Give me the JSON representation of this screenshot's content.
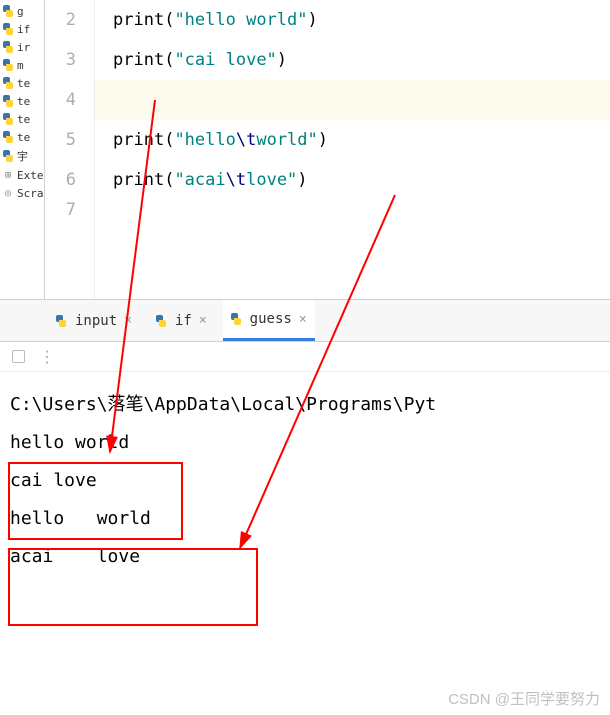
{
  "tree": {
    "items": [
      {
        "name": "g",
        "type": "py"
      },
      {
        "name": "if",
        "type": "py"
      },
      {
        "name": "ir",
        "type": "py"
      },
      {
        "name": "m",
        "type": "py"
      },
      {
        "name": "te",
        "type": "py"
      },
      {
        "name": "te",
        "type": "py"
      },
      {
        "name": "te",
        "type": "py"
      },
      {
        "name": "te",
        "type": "py"
      },
      {
        "name": "宇",
        "type": "py"
      }
    ],
    "ext": "Exte",
    "scratch": "Scra"
  },
  "editor": {
    "lines": [
      {
        "num": "2",
        "fn": "print",
        "str": "\"hello world\""
      },
      {
        "num": "3",
        "fn": "print",
        "str": "\"cai love\""
      },
      {
        "num": "4",
        "blank": true
      },
      {
        "num": "5",
        "fn": "print",
        "str_pre": "\"hello",
        "esc": "\\t",
        "str_post": "world\""
      },
      {
        "num": "6",
        "fn": "print",
        "str_pre": "\"acai",
        "esc": "\\t",
        "str_post": "love\""
      },
      {
        "num": "7",
        "mini": true
      }
    ]
  },
  "tabs": [
    {
      "label": "input",
      "active": false
    },
    {
      "label": "if",
      "active": false
    },
    {
      "label": "guess",
      "active": true
    }
  ],
  "output": {
    "path_pre": "C:\\Users\\",
    "path_cn": "落笔",
    "path_post": "\\AppData\\Local\\Programs\\Pyt",
    "lines": [
      "hello world",
      "cai love",
      "hello   world",
      "acai    love"
    ]
  },
  "watermark": "CSDN @王同学要努力"
}
